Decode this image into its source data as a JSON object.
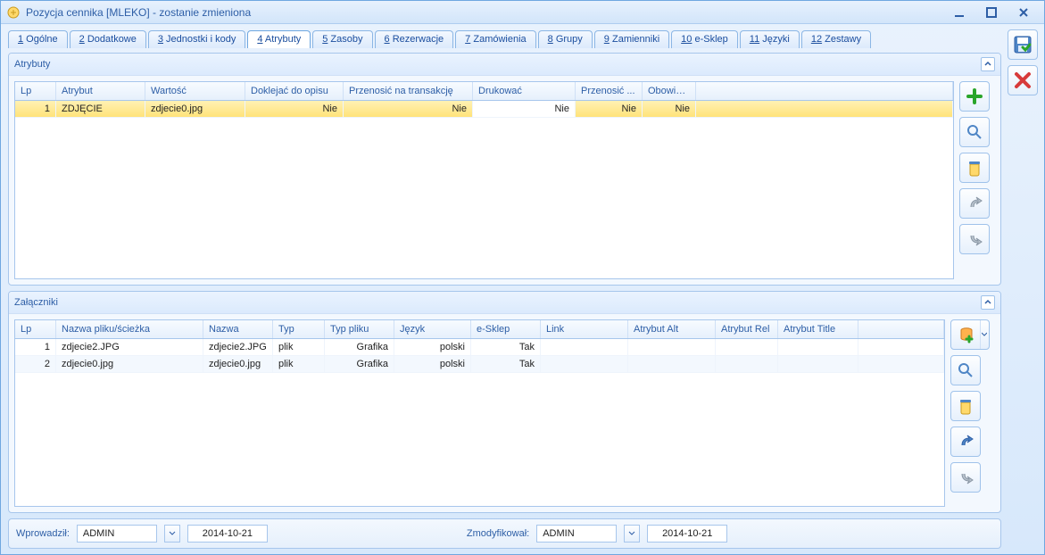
{
  "window": {
    "title": "Pozycja cennika [MLEKO] - zostanie zmieniona"
  },
  "tabs": [
    {
      "n": "1",
      "label": "Ogólne"
    },
    {
      "n": "2",
      "label": "Dodatkowe"
    },
    {
      "n": "3",
      "label": "Jednostki i kody"
    },
    {
      "n": "4",
      "label": "Atrybuty",
      "active": true
    },
    {
      "n": "5",
      "label": "Zasoby"
    },
    {
      "n": "6",
      "label": "Rezerwacje"
    },
    {
      "n": "7",
      "label": "Zamówienia"
    },
    {
      "n": "8",
      "label": "Grupy"
    },
    {
      "n": "9",
      "label": "Zamienniki"
    },
    {
      "n": "10",
      "label": "e-Sklep"
    },
    {
      "n": "11",
      "label": "Języki"
    },
    {
      "n": "12",
      "label": "Zestawy"
    }
  ],
  "attributes": {
    "title": "Atrybuty",
    "headers": [
      "Lp",
      "Atrybut",
      "Wartość",
      "Doklejać do opisu",
      "Przenosić na transakcję",
      "Drukować",
      "Przenosić ...",
      "Obowiąz..."
    ],
    "rows": [
      {
        "lp": "1",
        "atrybut": "ZDJĘCIE",
        "wartosc": "zdjecie0.jpg",
        "doklejac": "Nie",
        "przen_trans": "Nie",
        "drukowac": "Nie",
        "przenosic": "Nie",
        "obow": "Nie"
      }
    ]
  },
  "attachments": {
    "title": "Załączniki",
    "headers": [
      "Lp",
      "Nazwa pliku/ścieżka",
      "Nazwa",
      "Typ",
      "Typ pliku",
      "Język",
      "e-Sklep",
      "Link",
      "Atrybut Alt",
      "Atrybut Rel",
      "Atrybut Title"
    ],
    "rows": [
      {
        "lp": "1",
        "sciezka": "zdjecie2.JPG",
        "nazwa": "zdjecie2.JPG",
        "typ": "plik",
        "typpliku": "Grafika",
        "jezyk": "polski",
        "esklep": "Tak",
        "link": "",
        "alt": "",
        "rel": "",
        "title": ""
      },
      {
        "lp": "2",
        "sciezka": "zdjecie0.jpg",
        "nazwa": "zdjecie0.jpg",
        "typ": "plik",
        "typpliku": "Grafika",
        "jezyk": "polski",
        "esklep": "Tak",
        "link": "",
        "alt": "",
        "rel": "",
        "title": ""
      }
    ]
  },
  "footer": {
    "wprowadzil_label": "Wprowadził:",
    "wprowadzil_user": "ADMIN",
    "wprowadzil_date": "2014-10-21",
    "zmodyfikowal_label": "Zmodyfikował:",
    "zmodyfikowal_user": "ADMIN",
    "zmodyfikowal_date": "2014-10-21"
  }
}
